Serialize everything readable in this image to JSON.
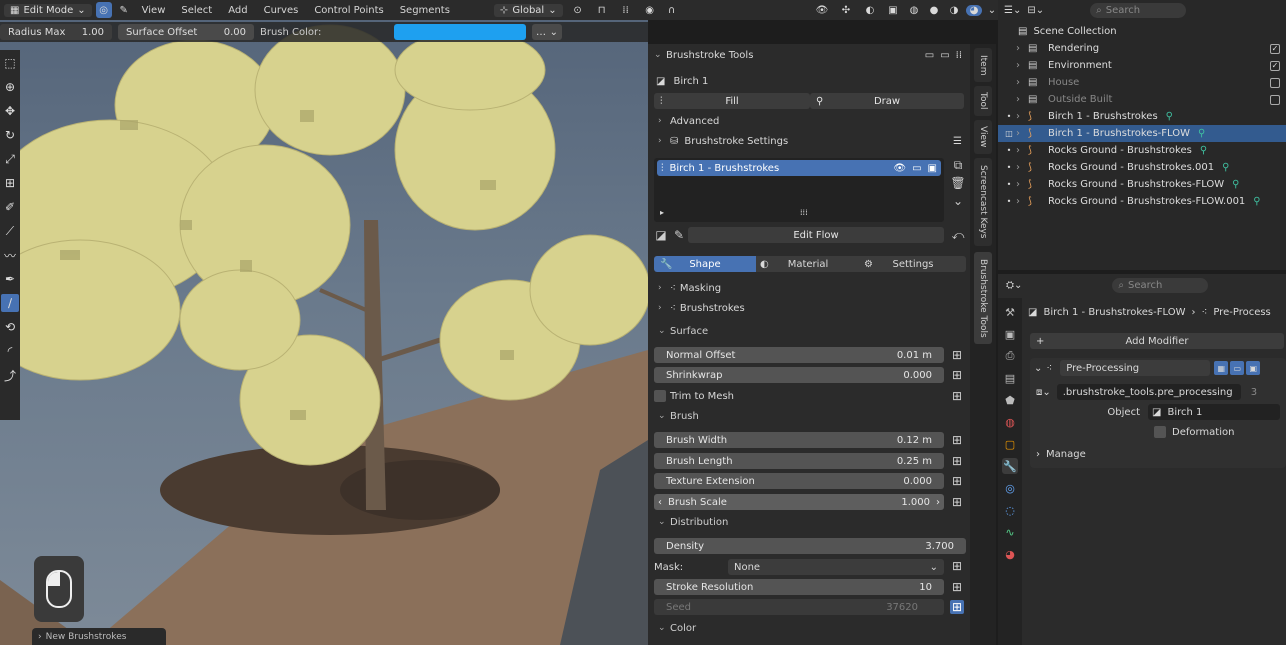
{
  "header": {
    "mode": "Edit Mode",
    "menus": [
      "View",
      "Select",
      "Add",
      "Curves",
      "Control Points",
      "Segments"
    ],
    "orientation": "Global"
  },
  "toolrow": {
    "radius_label": "Radius Max",
    "radius_value": "1.00",
    "offset_label": "Surface Offset",
    "offset_value": "0.00",
    "brush_color_label": "Brush Color:",
    "brush_color": "#1ea0f0"
  },
  "viewport": {
    "operator_label": "New Brushstrokes"
  },
  "panel": {
    "title": "Brushstroke Tools",
    "object_name": "Birch 1",
    "fill_label": "Fill",
    "draw_label": "Draw",
    "advanced_label": "Advanced",
    "settings_label": "Brushstroke Settings",
    "list_item": "Birch 1 - Brushstrokes",
    "edit_flow_label": "Edit Flow",
    "tabs": [
      "Shape",
      "Material",
      "Settings"
    ],
    "masking_label": "Masking",
    "brushstrokes_label": "Brushstrokes",
    "surface_label": "Surface",
    "normal_offset_label": "Normal Offset",
    "normal_offset_value": "0.01 m",
    "shrinkwrap_label": "Shrinkwrap",
    "shrinkwrap_value": "0.000",
    "trim_label": "Trim to Mesh",
    "brush_section": "Brush",
    "brush_width_label": "Brush Width",
    "brush_width_value": "0.12 m",
    "brush_length_label": "Brush Length",
    "brush_length_value": "0.25 m",
    "texture_ext_label": "Texture Extension",
    "texture_ext_value": "0.000",
    "brush_scale_label": "Brush Scale",
    "brush_scale_value": "1.000",
    "distribution_label": "Distribution",
    "density_label": "Density",
    "density_value": "3.700",
    "mask_label": "Mask:",
    "mask_value": "None",
    "stroke_res_label": "Stroke Resolution",
    "stroke_res_value": "10",
    "seed_label": "Seed",
    "seed_value": "37620",
    "color_label": "Color"
  },
  "vtabs": [
    "Item",
    "Tool",
    "View",
    "Screencast Keys",
    "Brushstroke Tools"
  ],
  "outliner": {
    "search_placeholder": "Search",
    "root": "Scene Collection",
    "items": [
      {
        "label": "Rendering",
        "kind": "collection",
        "selected": false
      },
      {
        "label": "Environment",
        "kind": "collection",
        "selected": false
      },
      {
        "label": "House",
        "kind": "collection",
        "selected": false,
        "disabled": true
      },
      {
        "label": "Outside Built",
        "kind": "collection",
        "selected": false,
        "disabled": true
      },
      {
        "label": "Birch 1 - Brushstrokes",
        "kind": "curves",
        "selected": false
      },
      {
        "label": "Birch 1 - Brushstrokes-FLOW",
        "kind": "curves",
        "selected": true
      },
      {
        "label": "Rocks Ground - Brushstrokes",
        "kind": "curves",
        "selected": false
      },
      {
        "label": "Rocks Ground - Brushstrokes.001",
        "kind": "curves",
        "selected": false
      },
      {
        "label": "Rocks Ground - Brushstrokes-FLOW",
        "kind": "curves",
        "selected": false
      },
      {
        "label": "Rocks Ground - Brushstrokes-FLOW.001",
        "kind": "curves",
        "selected": false
      }
    ]
  },
  "properties": {
    "search_placeholder": "Search",
    "breadcrumb_object": "Birch 1 - Brushstrokes-FLOW",
    "breadcrumb_modifier": "Pre-Process",
    "add_modifier_label": "Add Modifier",
    "modifier_name": "Pre-Processing",
    "node_group": ".brushstroke_tools.pre_processing",
    "node_users": "3",
    "object_label": "Object",
    "object_value": "Birch 1",
    "deformation_label": "Deformation",
    "manage_label": "Manage"
  }
}
